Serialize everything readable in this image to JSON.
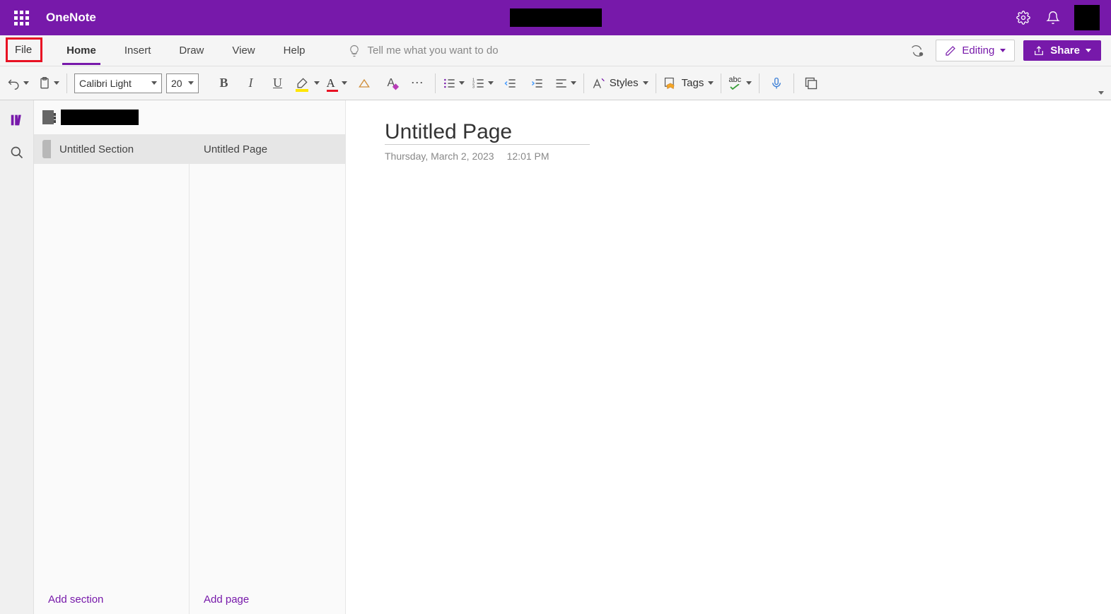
{
  "app": {
    "name": "OneNote"
  },
  "menu": {
    "file": "File",
    "tabs": [
      "Home",
      "Insert",
      "Draw",
      "View",
      "Help"
    ],
    "active_tab": "Home",
    "tell_me_placeholder": "Tell me what you want to do",
    "editing": "Editing",
    "share": "Share"
  },
  "ribbon": {
    "font_name": "Calibri Light",
    "font_size": "20",
    "styles_label": "Styles",
    "tags_label": "Tags",
    "spell_label": "abc"
  },
  "nav": {
    "section": "Untitled Section",
    "page": "Untitled Page",
    "add_section": "Add section",
    "add_page": "Add page"
  },
  "page": {
    "title": "Untitled Page",
    "date": "Thursday, March 2, 2023",
    "time": "12:01 PM"
  }
}
